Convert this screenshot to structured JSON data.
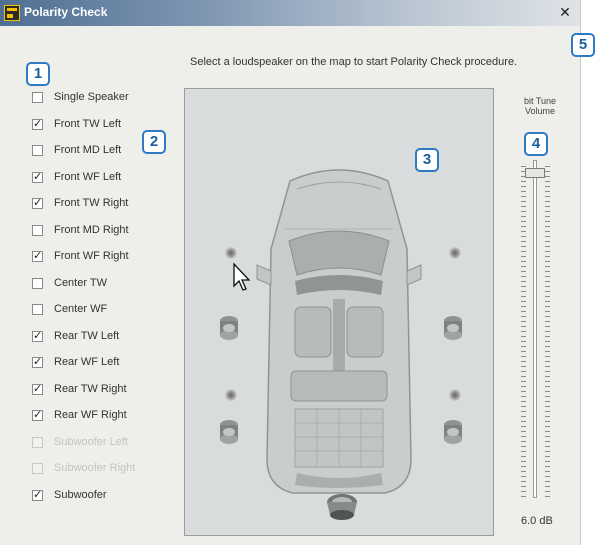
{
  "window": {
    "title": "Polarity Check",
    "close_symbol": "✕"
  },
  "instruction": "Select a loudspeaker on the map to start Polarity Check procedure.",
  "badges": [
    "1",
    "2",
    "3",
    "4",
    "5"
  ],
  "speakers": [
    {
      "label": "Single Speaker",
      "checked": false,
      "disabled": false
    },
    {
      "label": "Front TW Left",
      "checked": true,
      "disabled": false
    },
    {
      "label": "Front MD Left",
      "checked": false,
      "disabled": false
    },
    {
      "label": "Front WF Left",
      "checked": true,
      "disabled": false
    },
    {
      "label": "Front TW Right",
      "checked": true,
      "disabled": false
    },
    {
      "label": "Front MD Right",
      "checked": false,
      "disabled": false
    },
    {
      "label": "Front WF Right",
      "checked": true,
      "disabled": false
    },
    {
      "label": "Center TW",
      "checked": false,
      "disabled": false
    },
    {
      "label": "Center WF",
      "checked": false,
      "disabled": false
    },
    {
      "label": "Rear TW Left",
      "checked": true,
      "disabled": false
    },
    {
      "label": "Rear WF Left",
      "checked": true,
      "disabled": false
    },
    {
      "label": "Rear TW Right",
      "checked": true,
      "disabled": false
    },
    {
      "label": "Rear WF Right",
      "checked": true,
      "disabled": false
    },
    {
      "label": "Subwoofer Left",
      "checked": false,
      "disabled": true
    },
    {
      "label": "Subwoofer Right",
      "checked": false,
      "disabled": true
    },
    {
      "label": "Subwoofer",
      "checked": true,
      "disabled": false
    }
  ],
  "check_mark": "✓",
  "volume": {
    "heading_line1": "bit Tune",
    "heading_line2": "Volume",
    "value_label": "6.0 dB"
  },
  "colors": {
    "badge_border": "#2e7bc4",
    "titlebar_start": "#4f6f93"
  },
  "icons": {
    "app": "polarity-app-icon",
    "close": "close-icon",
    "cursor": "mouse-pointer-icon",
    "car": "car-top-view-icon"
  }
}
